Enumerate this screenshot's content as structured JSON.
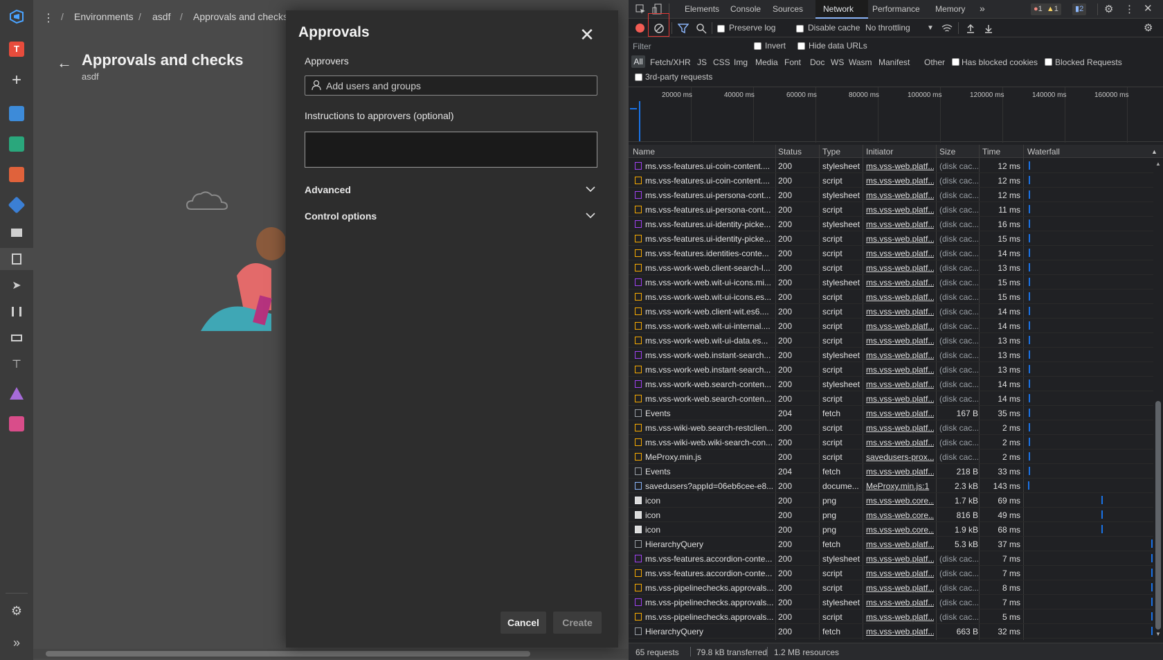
{
  "ado": {
    "breadcrumb": [
      "Environments",
      "asdf",
      "Approvals and checks"
    ],
    "separator": "/",
    "org_initial": "T",
    "page_title": "Approvals and checks",
    "page_subtitle": "asdf",
    "colors": {
      "accent": "#0078d4",
      "org_avatar": "#e74c3c"
    }
  },
  "dialog": {
    "title": "Approvals",
    "approvers_label": "Approvers",
    "approvers_placeholder": "Add users and groups",
    "instructions_label": "Instructions to approvers (optional)",
    "instructions_value": "",
    "sections": [
      "Advanced",
      "Control options"
    ],
    "cancel_label": "Cancel",
    "create_label": "Create"
  },
  "devtools": {
    "tabs": [
      "Elements",
      "Console",
      "Sources",
      "Network",
      "Performance",
      "Memory"
    ],
    "active_tab": "Network",
    "more_tabs": "»",
    "error_count": "1",
    "warning_count": "1",
    "message_count": "2",
    "toolbar": {
      "preserve_log": "Preserve log",
      "disable_cache": "Disable cache",
      "throttling": "No throttling"
    },
    "filter_placeholder": "Filter",
    "invert_label": "Invert",
    "hide_data_urls_label": "Hide data URLs",
    "type_filters": [
      "All",
      "Fetch/XHR",
      "JS",
      "CSS",
      "Img",
      "Media",
      "Font",
      "Doc",
      "WS",
      "Wasm",
      "Manifest",
      "Other"
    ],
    "has_blocked_cookies": "Has blocked cookies",
    "blocked_requests": "Blocked Requests",
    "third_party": "3rd-party requests",
    "overview_ticks": [
      "20000 ms",
      "40000 ms",
      "60000 ms",
      "80000 ms",
      "100000 ms",
      "120000 ms",
      "140000 ms",
      "160000 ms"
    ],
    "columns": [
      "Name",
      "Status",
      "Type",
      "Initiator",
      "Size",
      "Time",
      "Waterfall"
    ],
    "rows": [
      {
        "name": "ms.vss-features.ui-coin-content....",
        "status": "200",
        "type": "stylesheet",
        "initiator": "ms.vss-web.platf...",
        "size": "(disk cac...",
        "time": "12 ms",
        "kind": "css"
      },
      {
        "name": "ms.vss-features.ui-coin-content....",
        "status": "200",
        "type": "script",
        "initiator": "ms.vss-web.platf...",
        "size": "(disk cac...",
        "time": "12 ms",
        "kind": "js"
      },
      {
        "name": "ms.vss-features.ui-persona-cont...",
        "status": "200",
        "type": "stylesheet",
        "initiator": "ms.vss-web.platf...",
        "size": "(disk cac...",
        "time": "12 ms",
        "kind": "css"
      },
      {
        "name": "ms.vss-features.ui-persona-cont...",
        "status": "200",
        "type": "script",
        "initiator": "ms.vss-web.platf...",
        "size": "(disk cac...",
        "time": "11 ms",
        "kind": "js"
      },
      {
        "name": "ms.vss-features.ui-identity-picke...",
        "status": "200",
        "type": "stylesheet",
        "initiator": "ms.vss-web.platf...",
        "size": "(disk cac...",
        "time": "16 ms",
        "kind": "css"
      },
      {
        "name": "ms.vss-features.ui-identity-picke...",
        "status": "200",
        "type": "script",
        "initiator": "ms.vss-web.platf...",
        "size": "(disk cac...",
        "time": "15 ms",
        "kind": "js"
      },
      {
        "name": "ms.vss-features.identities-conte...",
        "status": "200",
        "type": "script",
        "initiator": "ms.vss-web.platf...",
        "size": "(disk cac...",
        "time": "14 ms",
        "kind": "js"
      },
      {
        "name": "ms.vss-work-web.client-search-l...",
        "status": "200",
        "type": "script",
        "initiator": "ms.vss-web.platf...",
        "size": "(disk cac...",
        "time": "13 ms",
        "kind": "js"
      },
      {
        "name": "ms.vss-work-web.wit-ui-icons.mi...",
        "status": "200",
        "type": "stylesheet",
        "initiator": "ms.vss-web.platf...",
        "size": "(disk cac...",
        "time": "15 ms",
        "kind": "css"
      },
      {
        "name": "ms.vss-work-web.wit-ui-icons.es...",
        "status": "200",
        "type": "script",
        "initiator": "ms.vss-web.platf...",
        "size": "(disk cac...",
        "time": "15 ms",
        "kind": "js"
      },
      {
        "name": "ms.vss-work-web.client-wit.es6....",
        "status": "200",
        "type": "script",
        "initiator": "ms.vss-web.platf...",
        "size": "(disk cac...",
        "time": "14 ms",
        "kind": "js"
      },
      {
        "name": "ms.vss-work-web.wit-ui-internal....",
        "status": "200",
        "type": "script",
        "initiator": "ms.vss-web.platf...",
        "size": "(disk cac...",
        "time": "14 ms",
        "kind": "js"
      },
      {
        "name": "ms.vss-work-web.wit-ui-data.es...",
        "status": "200",
        "type": "script",
        "initiator": "ms.vss-web.platf...",
        "size": "(disk cac...",
        "time": "13 ms",
        "kind": "js"
      },
      {
        "name": "ms.vss-work-web.instant-search...",
        "status": "200",
        "type": "stylesheet",
        "initiator": "ms.vss-web.platf...",
        "size": "(disk cac...",
        "time": "13 ms",
        "kind": "css"
      },
      {
        "name": "ms.vss-work-web.instant-search...",
        "status": "200",
        "type": "script",
        "initiator": "ms.vss-web.platf...",
        "size": "(disk cac...",
        "time": "13 ms",
        "kind": "js"
      },
      {
        "name": "ms.vss-work-web.search-conten...",
        "status": "200",
        "type": "stylesheet",
        "initiator": "ms.vss-web.platf...",
        "size": "(disk cac...",
        "time": "14 ms",
        "kind": "css"
      },
      {
        "name": "ms.vss-work-web.search-conten...",
        "status": "200",
        "type": "script",
        "initiator": "ms.vss-web.platf...",
        "size": "(disk cac...",
        "time": "14 ms",
        "kind": "js"
      },
      {
        "name": "Events",
        "status": "204",
        "type": "fetch",
        "initiator": "ms.vss-web.platf...",
        "size": "167 B",
        "time": "35 ms",
        "kind": "fetch"
      },
      {
        "name": "ms.vss-wiki-web.search-restclien...",
        "status": "200",
        "type": "script",
        "initiator": "ms.vss-web.platf...",
        "size": "(disk cac...",
        "time": "2 ms",
        "kind": "js"
      },
      {
        "name": "ms.vss-wiki-web.wiki-search-con...",
        "status": "200",
        "type": "script",
        "initiator": "ms.vss-web.platf...",
        "size": "(disk cac...",
        "time": "2 ms",
        "kind": "js"
      },
      {
        "name": "MeProxy.min.js",
        "status": "200",
        "type": "script",
        "initiator": "savedusers-prox...",
        "size": "(disk cac...",
        "time": "2 ms",
        "kind": "js"
      },
      {
        "name": "Events",
        "status": "204",
        "type": "fetch",
        "initiator": "ms.vss-web.platf...",
        "size": "218 B",
        "time": "33 ms",
        "kind": "fetch"
      },
      {
        "name": "savedusers?appId=06eb6cee-e8...",
        "status": "200",
        "type": "docume...",
        "initiator": "MeProxy.min.js:1",
        "size": "2.3 kB",
        "time": "143 ms",
        "kind": "doc"
      },
      {
        "name": "icon",
        "status": "200",
        "type": "png",
        "initiator": "ms.vss-web.core...",
        "size": "1.7 kB",
        "time": "69 ms",
        "kind": "png"
      },
      {
        "name": "icon",
        "status": "200",
        "type": "png",
        "initiator": "ms.vss-web.core...",
        "size": "816 B",
        "time": "49 ms",
        "kind": "png"
      },
      {
        "name": "icon",
        "status": "200",
        "type": "png",
        "initiator": "ms.vss-web.core...",
        "size": "1.9 kB",
        "time": "68 ms",
        "kind": "png"
      },
      {
        "name": "HierarchyQuery",
        "status": "200",
        "type": "fetch",
        "initiator": "ms.vss-web.platf...",
        "size": "5.3 kB",
        "time": "37 ms",
        "kind": "fetch"
      },
      {
        "name": "ms.vss-features.accordion-conte...",
        "status": "200",
        "type": "stylesheet",
        "initiator": "ms.vss-web.platf...",
        "size": "(disk cac...",
        "time": "7 ms",
        "kind": "css"
      },
      {
        "name": "ms.vss-features.accordion-conte...",
        "status": "200",
        "type": "script",
        "initiator": "ms.vss-web.platf...",
        "size": "(disk cac...",
        "time": "7 ms",
        "kind": "js"
      },
      {
        "name": "ms.vss-pipelinechecks.approvals...",
        "status": "200",
        "type": "script",
        "initiator": "ms.vss-web.platf...",
        "size": "(disk cac...",
        "time": "8 ms",
        "kind": "js"
      },
      {
        "name": "ms.vss-pipelinechecks.approvals...",
        "status": "200",
        "type": "stylesheet",
        "initiator": "ms.vss-web.platf...",
        "size": "(disk cac...",
        "time": "7 ms",
        "kind": "css"
      },
      {
        "name": "ms.vss-pipelinechecks.approvals...",
        "status": "200",
        "type": "script",
        "initiator": "ms.vss-web.platf...",
        "size": "(disk cac...",
        "time": "5 ms",
        "kind": "js"
      },
      {
        "name": "HierarchyQuery",
        "status": "200",
        "type": "fetch",
        "initiator": "ms.vss-web.platf...",
        "size": "663 B",
        "time": "32 ms",
        "kind": "fetch"
      }
    ],
    "status_bar": {
      "requests": "65 requests",
      "transferred": "79.8 kB transferred",
      "resources": "1.2 MB resources"
    },
    "colors": {
      "record": "#f25c54",
      "active_tab_underline": "#8ab4f8",
      "waterfall": "#1a73e8",
      "highlight_box": "#e53935"
    }
  }
}
